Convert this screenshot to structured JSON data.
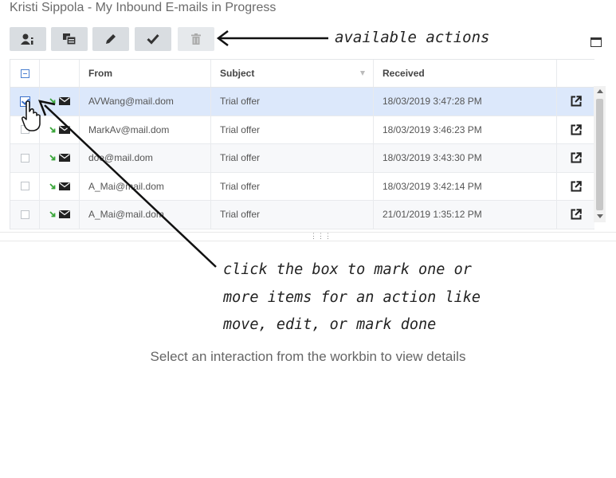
{
  "header": {
    "title": "Kristi Sippola - My Inbound E-mails in Progress"
  },
  "toolbar": {
    "buttons": [
      {
        "icon": "assign-icon",
        "enabled": true
      },
      {
        "icon": "move-icon",
        "enabled": true
      },
      {
        "icon": "pencil-icon",
        "enabled": true
      },
      {
        "icon": "checkmark-icon",
        "enabled": true
      },
      {
        "icon": "trash-icon",
        "enabled": false
      }
    ]
  },
  "annotations": {
    "actions": "available actions",
    "click_lines": [
      "click the box to mark one or",
      "more items for an action like",
      "move, edit, or mark done"
    ]
  },
  "grid": {
    "columns": {
      "from": "From",
      "subject": "Subject",
      "received": "Received"
    },
    "rows": [
      {
        "from": "AVWang@mail.dom",
        "subject": "Trial offer",
        "received": "18/03/2019 3:47:28 PM",
        "selected": true
      },
      {
        "from": "MarkAv@mail.dom",
        "subject": "Trial offer",
        "received": "18/03/2019 3:46:23 PM",
        "selected": false
      },
      {
        "from": "doe@mail.dom",
        "subject": "Trial offer",
        "received": "18/03/2019 3:43:30 PM",
        "selected": false
      },
      {
        "from": "A_Mai@mail.dom",
        "subject": "Trial offer",
        "received": "18/03/2019 3:42:14 PM",
        "selected": false
      },
      {
        "from": "A_Mai@mail.dom",
        "subject": "Trial offer",
        "received": "21/01/2019 1:35:12 PM",
        "selected": false
      }
    ]
  },
  "details": {
    "empty_message": "Select an interaction from the workbin to view details"
  },
  "colors": {
    "accent": "#3a6fc9",
    "selected_row": "#dce8fb",
    "inbound_arrow": "#3aa53a"
  }
}
